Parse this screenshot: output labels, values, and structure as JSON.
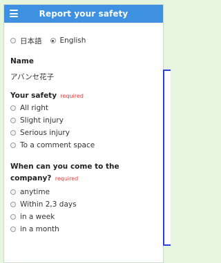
{
  "header": {
    "title": "Report your safety"
  },
  "language": {
    "options": [
      {
        "label": "日本語",
        "checked": false
      },
      {
        "label": "English",
        "checked": true
      }
    ]
  },
  "name": {
    "label": "Name",
    "value": "アバンセ花子"
  },
  "safety": {
    "label": "Your safety",
    "required": "required",
    "options": [
      "All right",
      "Slight injury",
      "Serious injury",
      "To a comment space"
    ]
  },
  "come": {
    "label_line1": "When can you come to the",
    "label_line2": "company?",
    "required": "required",
    "options": [
      "anytime",
      "Within 2,3 days",
      "in a week",
      "in a month"
    ]
  },
  "colors": {
    "header": "#3d91e0",
    "required": "#e03b3b",
    "page_bg": "#e6f5dd",
    "panel_border": "#2a3fd6"
  },
  "icons": {
    "menu": "hamburger-icon"
  }
}
